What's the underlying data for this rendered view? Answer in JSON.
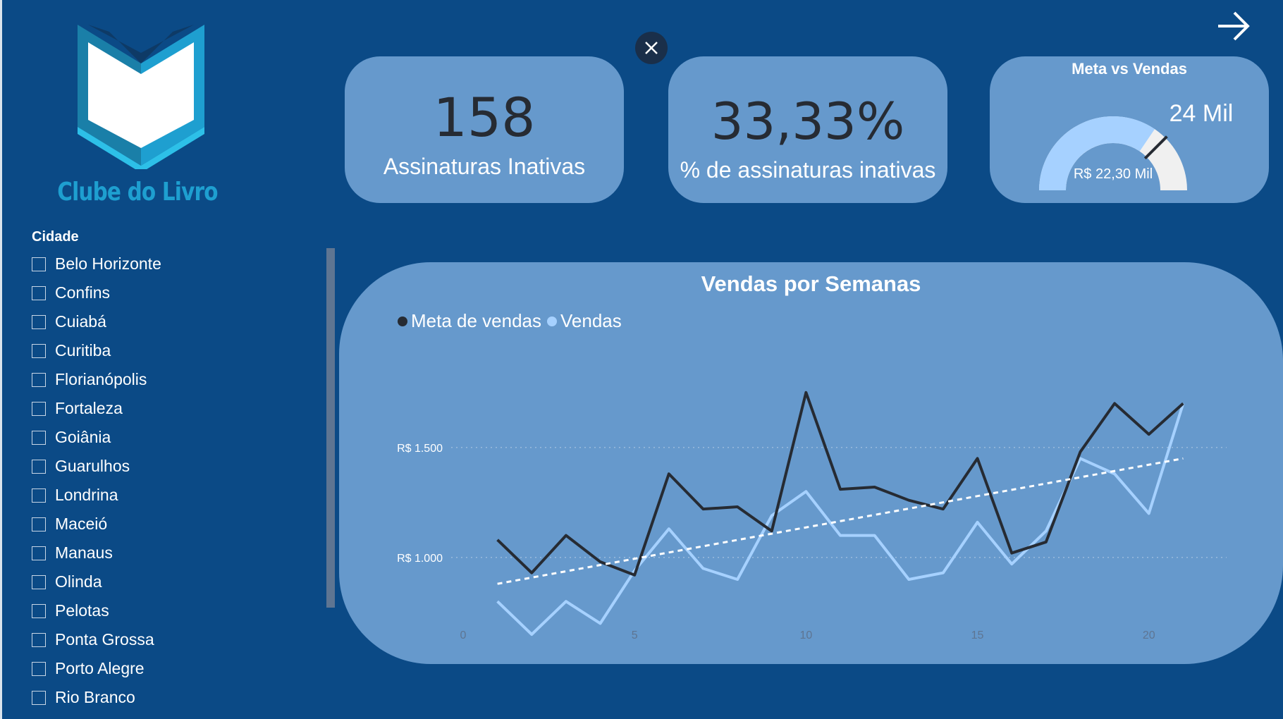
{
  "brand": {
    "name": "Clube do Livro"
  },
  "icons": {
    "logo": "book-logo-icon",
    "close": "close-icon",
    "next": "arrow-right-icon",
    "checkbox": "checkbox-icon"
  },
  "slicer": {
    "title": "Cidade",
    "items": [
      "Belo Horizonte",
      "Confins",
      "Cuiabá",
      "Curitiba",
      "Florianópolis",
      "Fortaleza",
      "Goiânia",
      "Guarulhos",
      "Londrina",
      "Maceió",
      "Manaus",
      "Olinda",
      "Pelotas",
      "Ponta Grossa",
      "Porto Alegre",
      "Rio Branco"
    ]
  },
  "kpis": [
    {
      "value": "158",
      "label": "Assinaturas Inativas"
    },
    {
      "value": "33,33%",
      "label": "% de assinaturas inativas"
    }
  ],
  "gauge": {
    "title": "Meta vs Vendas",
    "value_label": "R$ 22,30 Mil",
    "target_label": "24 Mil",
    "value_fraction": 0.69,
    "target_fraction": 0.75,
    "colors": {
      "fill": "#a6d1ff",
      "track": "#f0f0f0",
      "target": "#262b33"
    }
  },
  "chart_data": {
    "type": "line",
    "title": "Vendas por Semanas",
    "legend_position": "top-left",
    "xlim": [
      0,
      22
    ],
    "ylim": [
      650,
      1900
    ],
    "x_ticks": [
      "0",
      "5",
      "10",
      "15",
      "20"
    ],
    "y_ticks": [
      {
        "value": 1000,
        "label": "R$ 1.000"
      },
      {
        "value": 1500,
        "label": "R$ 1.500"
      }
    ],
    "grid": "horizontal-dotted",
    "x": [
      1,
      2,
      3,
      4,
      5,
      6,
      7,
      8,
      9,
      10,
      11,
      12,
      13,
      14,
      15,
      16,
      17,
      18,
      19,
      20,
      21
    ],
    "series": [
      {
        "name": "Meta de vendas",
        "color": "#262b33",
        "values": [
          1080,
          930,
          1100,
          980,
          920,
          1380,
          1220,
          1230,
          1120,
          1750,
          1310,
          1320,
          1260,
          1220,
          1450,
          1020,
          1070,
          1480,
          1700,
          1560,
          1700
        ]
      },
      {
        "name": "Vendas",
        "color": "#a6d1ff",
        "values": [
          800,
          650,
          800,
          700,
          940,
          1130,
          950,
          900,
          1190,
          1300,
          1100,
          1100,
          900,
          930,
          1160,
          970,
          1120,
          1450,
          1380,
          1200,
          1700
        ]
      }
    ],
    "trendline": {
      "from": [
        1,
        880
      ],
      "to": [
        21,
        1450
      ],
      "color": "#ffffff",
      "style": "dashed"
    }
  }
}
